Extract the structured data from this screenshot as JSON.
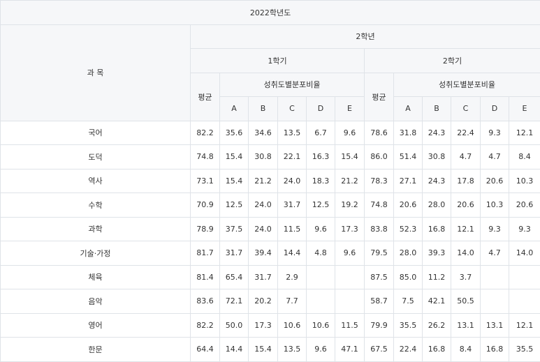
{
  "table": {
    "year_title": "2022학년도",
    "subject_header": "과 목",
    "grade_header": "2학년",
    "sem1_header": "1학기",
    "sem2_header": "2학기",
    "avg_header": "평균",
    "dist_header": "성취도별분포비율",
    "grade_letters": [
      "A",
      "B",
      "C",
      "D",
      "E"
    ],
    "rows": [
      {
        "subject": "국어",
        "s1": [
          "82.2",
          "35.6",
          "34.6",
          "13.5",
          "6.7",
          "9.6"
        ],
        "s2": [
          "78.6",
          "31.8",
          "24.3",
          "22.4",
          "9.3",
          "12.1"
        ]
      },
      {
        "subject": "도덕",
        "s1": [
          "74.8",
          "15.4",
          "30.8",
          "22.1",
          "16.3",
          "15.4"
        ],
        "s2": [
          "86.0",
          "51.4",
          "30.8",
          "4.7",
          "4.7",
          "8.4"
        ]
      },
      {
        "subject": "역사",
        "s1": [
          "73.1",
          "15.4",
          "21.2",
          "24.0",
          "18.3",
          "21.2"
        ],
        "s2": [
          "78.3",
          "27.1",
          "24.3",
          "17.8",
          "20.6",
          "10.3"
        ]
      },
      {
        "subject": "수학",
        "s1": [
          "70.9",
          "12.5",
          "24.0",
          "31.7",
          "12.5",
          "19.2"
        ],
        "s2": [
          "74.8",
          "20.6",
          "28.0",
          "20.6",
          "10.3",
          "20.6"
        ]
      },
      {
        "subject": "과학",
        "s1": [
          "78.9",
          "37.5",
          "24.0",
          "11.5",
          "9.6",
          "17.3"
        ],
        "s2": [
          "83.8",
          "52.3",
          "16.8",
          "12.1",
          "9.3",
          "9.3"
        ]
      },
      {
        "subject": "기술·가정",
        "s1": [
          "81.7",
          "31.7",
          "39.4",
          "14.4",
          "4.8",
          "9.6"
        ],
        "s2": [
          "79.5",
          "28.0",
          "39.3",
          "14.0",
          "4.7",
          "14.0"
        ]
      },
      {
        "subject": "체육",
        "s1": [
          "81.4",
          "65.4",
          "31.7",
          "2.9",
          "",
          ""
        ],
        "s2": [
          "87.5",
          "85.0",
          "11.2",
          "3.7",
          "",
          ""
        ]
      },
      {
        "subject": "음악",
        "s1": [
          "83.6",
          "72.1",
          "20.2",
          "7.7",
          "",
          ""
        ],
        "s2": [
          "58.7",
          "7.5",
          "42.1",
          "50.5",
          "",
          ""
        ]
      },
      {
        "subject": "영어",
        "s1": [
          "82.2",
          "50.0",
          "17.3",
          "10.6",
          "10.6",
          "11.5"
        ],
        "s2": [
          "79.9",
          "35.5",
          "26.2",
          "13.1",
          "13.1",
          "12.1"
        ]
      },
      {
        "subject": "한문",
        "s1": [
          "64.4",
          "14.4",
          "15.4",
          "13.5",
          "9.6",
          "47.1"
        ],
        "s2": [
          "67.5",
          "22.4",
          "16.8",
          "8.4",
          "16.8",
          "35.5"
        ]
      }
    ]
  }
}
